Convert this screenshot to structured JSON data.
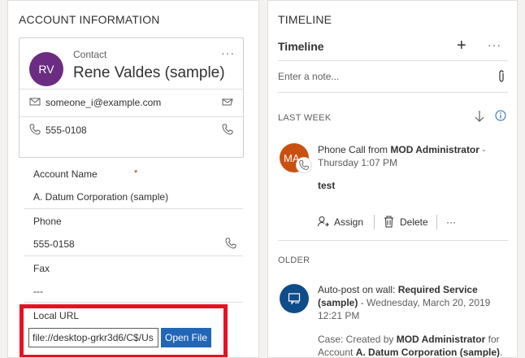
{
  "account": {
    "section_title": "ACCOUNT INFORMATION",
    "contact": {
      "initials": "RV",
      "kind": "Contact",
      "name": "Rene Valdes (sample)",
      "email": "someone_i@example.com",
      "phone": "555-0108"
    },
    "fields": {
      "account_name_label": "Account Name",
      "account_name_required": "*",
      "account_name_value": "A. Datum Corporation (sample)",
      "phone_label": "Phone",
      "phone_value": "555-0158",
      "fax_label": "Fax",
      "fax_value": "---",
      "local_url_label": "Local URL",
      "local_url_value": "file://desktop-grkr3d6/C$/Us",
      "open_file_label": "Open File"
    }
  },
  "timeline": {
    "section_title": "TIMELINE",
    "header": "Timeline",
    "add_symbol": "+",
    "more_symbol": "···",
    "note_placeholder": "Enter a note...",
    "groups": {
      "last_week": "LAST WEEK",
      "older": "OLDER"
    },
    "phone_call": {
      "initials": "MA",
      "prefix": "Phone Call from ",
      "who": "MOD Administrator",
      "sep": " - ",
      "when": "Thursday 1:07 PM",
      "body": "test",
      "assign_label": "Assign",
      "delete_label": "Delete",
      "more_label": "···"
    },
    "auto_post": {
      "prefix": "Auto-post on wall: ",
      "subject": "Required Service (sample)",
      "sep": " - ",
      "when": "Wednesday, March 20, 2019 12:21 PM",
      "body_prefix": "Case: Created by ",
      "body_who": "MOD Administrator",
      "body_mid": " for Account ",
      "body_account": "A. Datum Corporation (sample)",
      "body_end": "."
    }
  },
  "colors": {
    "accent": "#2266b8",
    "highlight": "#e81123",
    "avatar_contact": "#6b2c82",
    "avatar_activity": "#ca5010",
    "avatar_post": "#0f4c8a"
  }
}
